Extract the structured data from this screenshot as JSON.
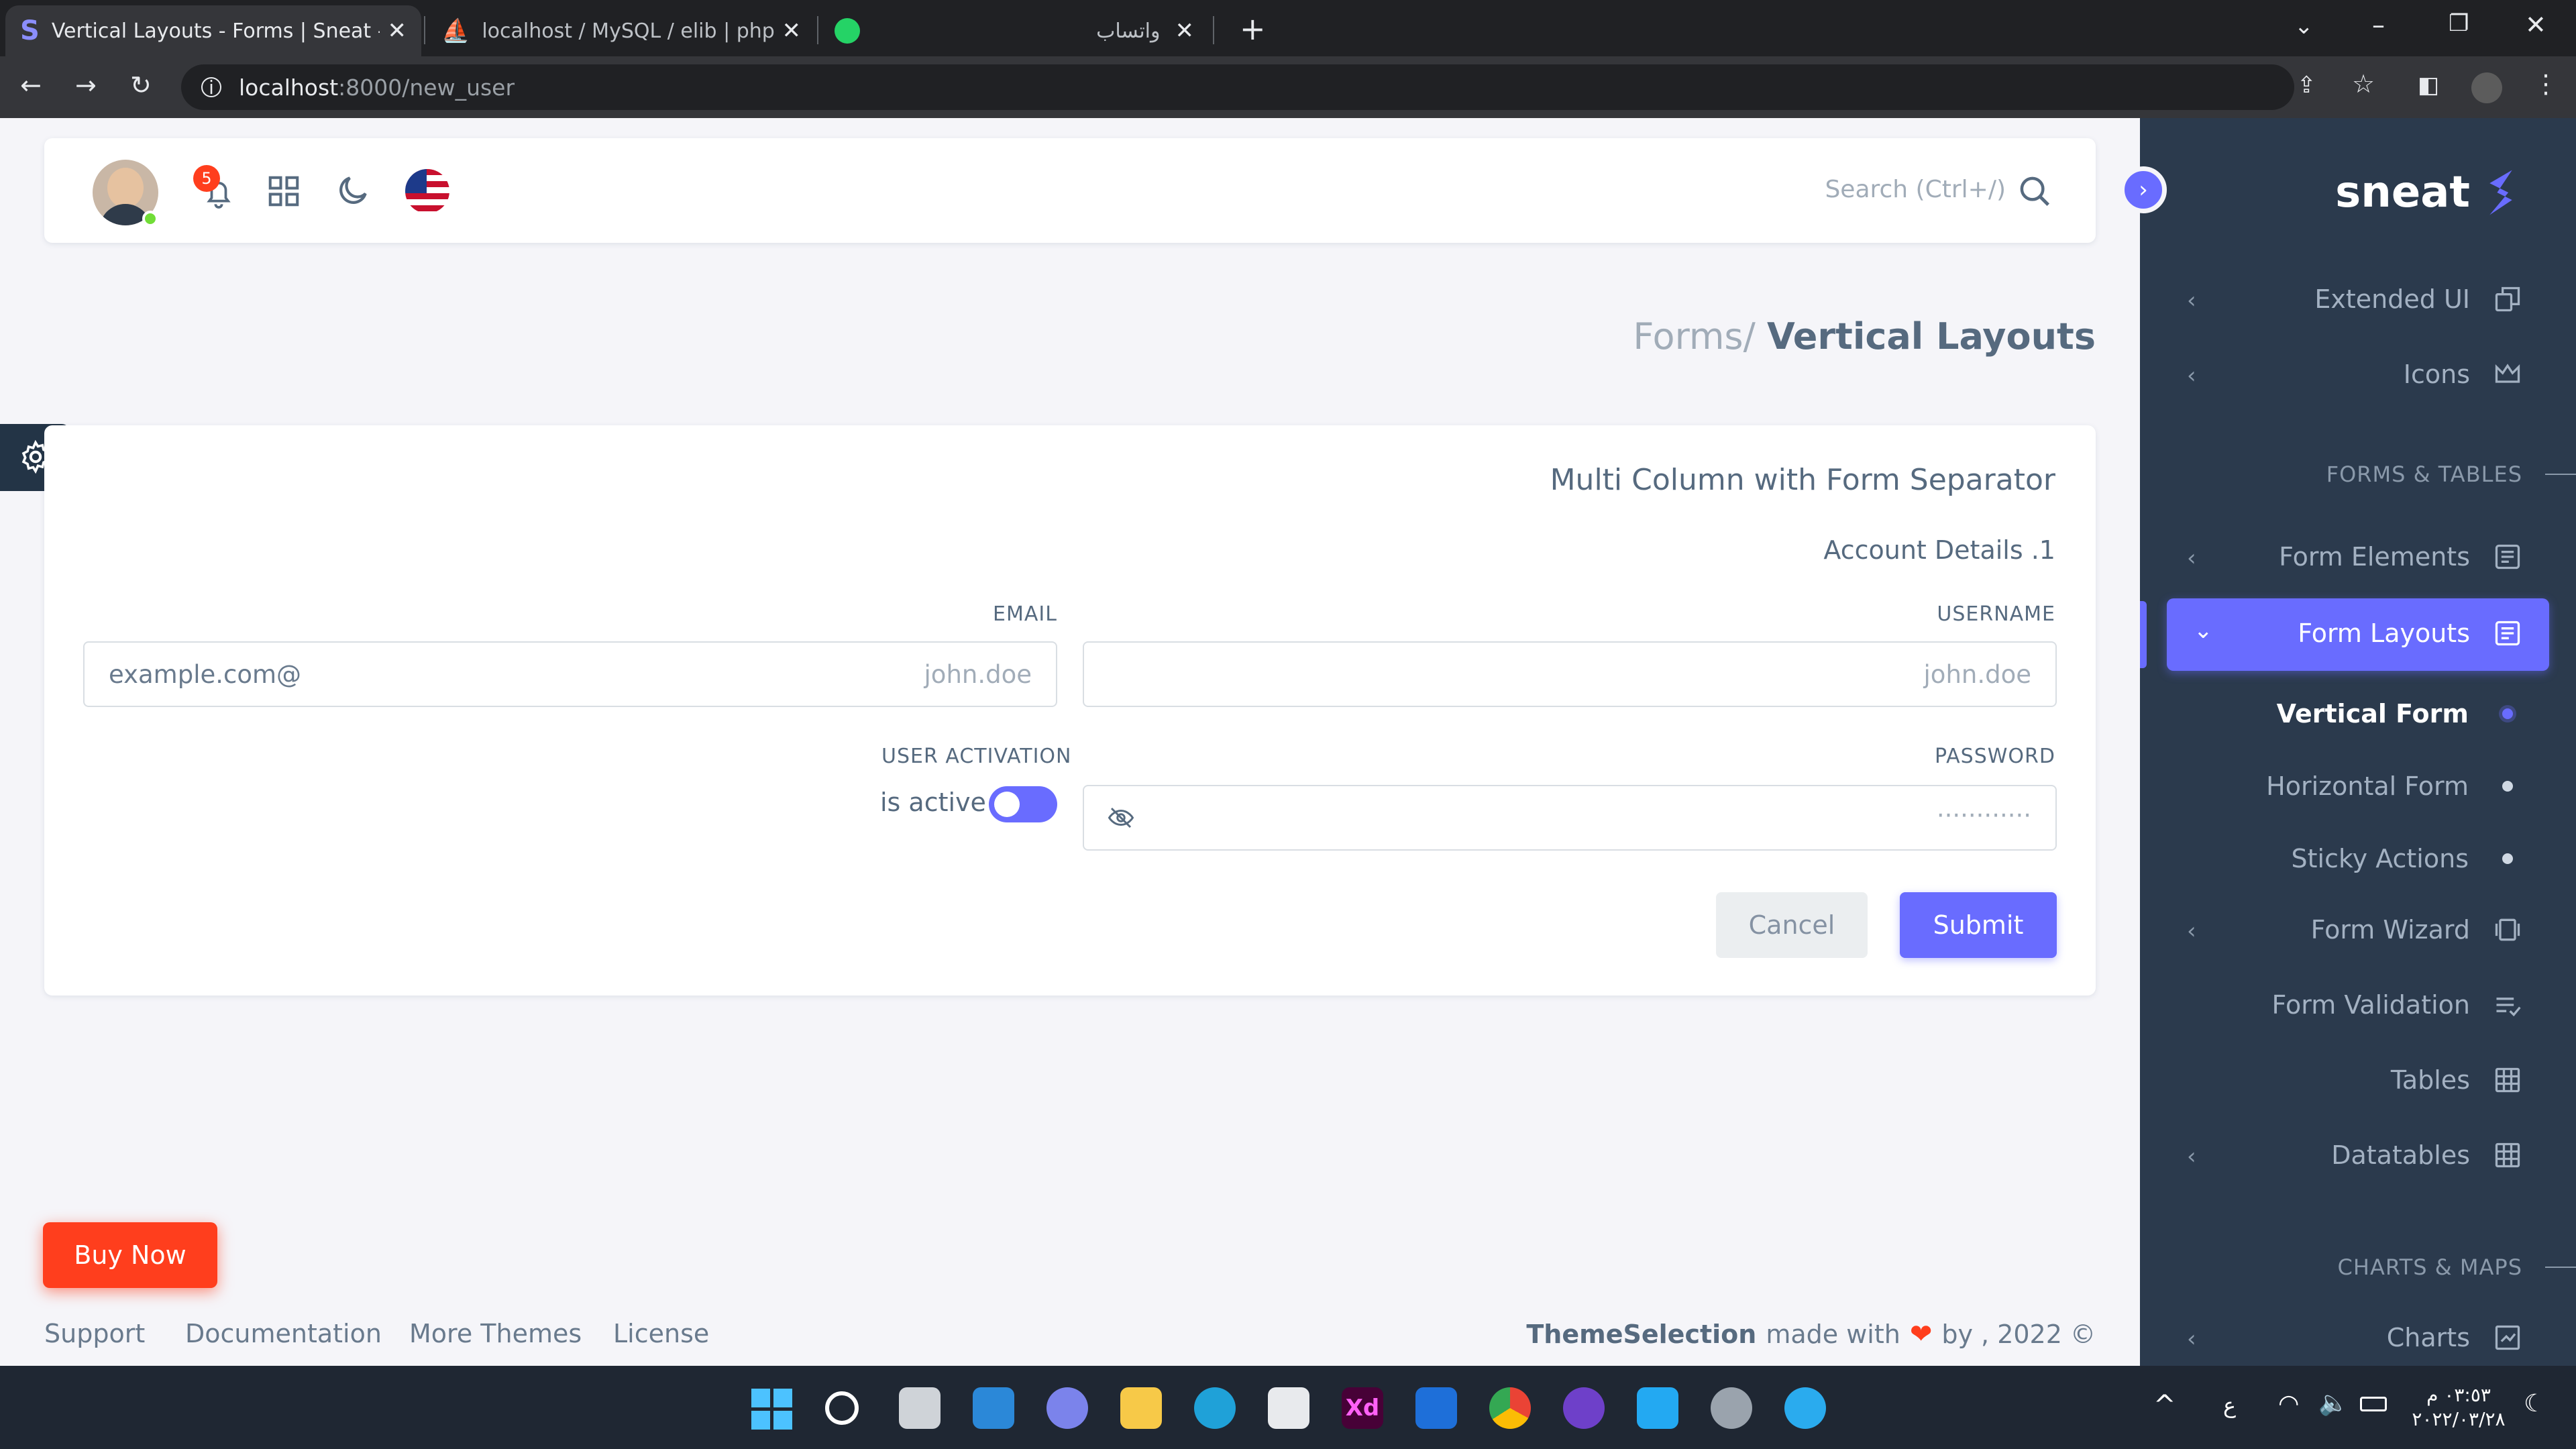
{
  "browser": {
    "tabs": [
      {
        "title": "Vertical Layouts - Forms | Sneat -",
        "active": true
      },
      {
        "title": "localhost / MySQL / elib | phpMy",
        "active": false
      },
      {
        "title": "واتساب",
        "active": false
      }
    ],
    "url_host": "localhost",
    "url_path": ":8000/new_user"
  },
  "topnav": {
    "notification_count": "5",
    "search_placeholder": "Search (Ctrl+/)"
  },
  "breadcrumb": {
    "parent": "Forms/",
    "current": "Vertical Layouts"
  },
  "form": {
    "title": "Multi Column with Form Separator",
    "section": "Account Details .1",
    "username_label": "USERNAME",
    "username_placeholder": "john.doe",
    "email_label": "EMAIL",
    "email_placeholder": "john.doe",
    "email_suffix": "example.com@",
    "password_label": "PASSWORD",
    "password_placeholder": "············",
    "activation_label": "USER ACTIVATION",
    "activation_text": "is active",
    "activation_on": true,
    "submit": "Submit",
    "cancel": "Cancel"
  },
  "buy_now": "Buy Now",
  "footer": {
    "links": [
      "Support",
      "Documentation",
      "More Themes",
      "License"
    ],
    "brand": "ThemeSelection",
    "made_with": "made with",
    "by": "by , 2022 ©"
  },
  "sidebar": {
    "brand": "sneat",
    "items": [
      {
        "label": "Extended UI",
        "icon": "copy-icon"
      },
      {
        "label": "Icons",
        "icon": "crown-icon"
      },
      {
        "section": "FORMS & TABLES"
      },
      {
        "label": "Form Elements",
        "icon": "form-icon"
      },
      {
        "label": "Form Layouts",
        "icon": "form-icon",
        "active": true
      },
      {
        "label": "Vertical Form",
        "sub": true,
        "active": true
      },
      {
        "label": "Horizontal Form",
        "sub": true
      },
      {
        "label": "Sticky Actions",
        "sub": true
      },
      {
        "label": "Form Wizard",
        "icon": "carousel-icon"
      },
      {
        "label": "Form Validation",
        "icon": "checklist-icon"
      },
      {
        "label": "Tables",
        "icon": "table-icon"
      },
      {
        "label": "Datatables",
        "icon": "grid-icon"
      },
      {
        "section": "CHARTS & MAPS"
      },
      {
        "label": "Charts",
        "icon": "chart-icon"
      }
    ]
  },
  "system_tray": {
    "lang": "ع",
    "time": "٠٣:٥٣ م",
    "date": "٢٠٢٢/٠٣/٢٨"
  },
  "colors": {
    "primary": "#696cff",
    "sidebar": "#2b3a4d",
    "buy_now": "#ff3e1d"
  }
}
